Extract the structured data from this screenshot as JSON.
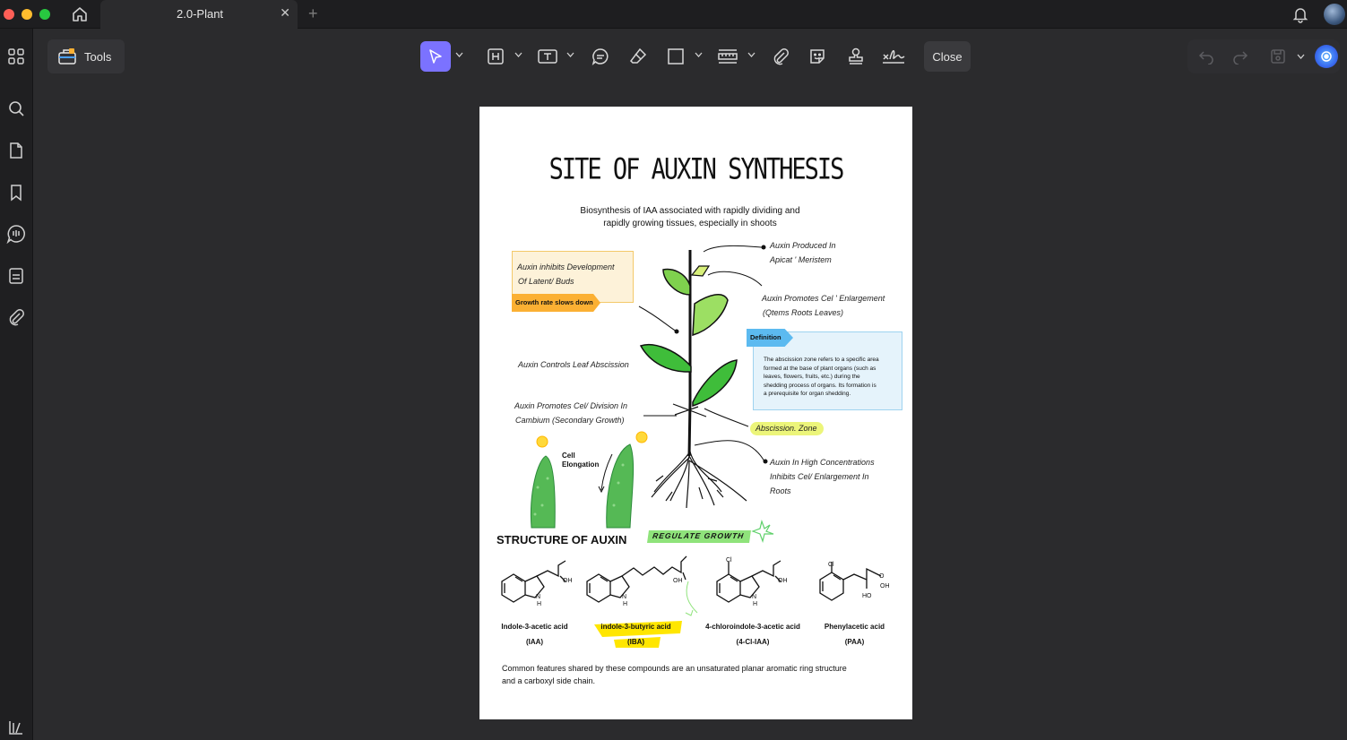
{
  "window": {
    "tab_title": "2.0-Plant",
    "new_tab": "+"
  },
  "toolbar": {
    "tools_label": "Tools",
    "close_label": "Close"
  },
  "icons": {
    "sidebar": [
      "apps-grid-icon",
      "search-icon",
      "page-icon",
      "bookmark-icon",
      "comment-list-icon",
      "form-icon",
      "attachment-icon",
      "library-icon"
    ],
    "toolbar": [
      "select-icon",
      "heading-icon",
      "text-box-icon",
      "comment-icon",
      "eraser-icon",
      "rectangle-icon",
      "measure-icon",
      "paperclip-icon",
      "sticker-icon",
      "stamp-icon",
      "signature-icon"
    ],
    "right": [
      "undo-icon",
      "redo-icon",
      "save-icon",
      "ai-assistant-icon"
    ]
  },
  "colors": {
    "accent": "#7b72ff",
    "page_bg": "#ffffff",
    "app_bg": "#2b2b2d",
    "highlight_yellow": "#ffe600",
    "note_orange": "#fbb033",
    "note_blue": "#e5f3fb"
  },
  "document": {
    "title": "SITE OF AUXIN SYNTHESIS",
    "subtitle_line1": "Biosynthesis of IAA associated with rapidly dividing and",
    "subtitle_line2": "rapidly growing tissues, especially in shoots",
    "note_box": {
      "line1": "Auxin inhibits Development",
      "line2": "Of Latent/ Buds",
      "tag": "Growth rate slows down"
    },
    "labels": {
      "produced_1": "Auxin Produced In",
      "produced_2": "Apicat ' Meristem",
      "promotes_1": "Auxin Promotes Cel ' Enlargement",
      "promotes_2": "(Qtems Roots Leaves)",
      "abscission_ctrl": "Auxin Controls Leaf Abscission",
      "cambium_1": "Auxin Promotes Cel/ Division In",
      "cambium_2": "Cambium (Secondary Growth)",
      "zone": "Abscission. Zone",
      "high_1": "Auxin In High Concentrations",
      "high_2": "Inhibits Cel/ Enlargement In",
      "high_3": "Roots",
      "cell_1": "Cell",
      "cell_2": "Elongation"
    },
    "definition": {
      "tag": "Definition",
      "lines": [
        "The abscission zone refers to a specific area",
        "formed at the base of plant organs (such as",
        "leaves, flowers, fruits, etc.) during the",
        "shedding process of organs. Its formation is",
        "a prerequisite for organ shedding."
      ]
    },
    "structure_title": "STRUCTURE OF AUXIN",
    "regulate_tag": "REGULATE GROWTH",
    "compounds": [
      {
        "name": "Indole-3-acetic acid",
        "abbr": "(IAA)"
      },
      {
        "name": "indole-3-butyric acid",
        "abbr": "(IBA)"
      },
      {
        "name": "4-chloroindole-3-acetic acid",
        "abbr": "(4-Cl-IAA)"
      },
      {
        "name": "Phenylacetic acid",
        "abbr": "(PAA)"
      }
    ],
    "chem": {
      "oh": "OH",
      "n": "N",
      "h": "H",
      "cl": "Cl",
      "o": "O",
      "ho": "HO"
    },
    "footer_line1": "Common features shared by these compounds are an unsaturated planar aromatic ring structure",
    "footer_line2": "and a carboxyl side chain."
  }
}
